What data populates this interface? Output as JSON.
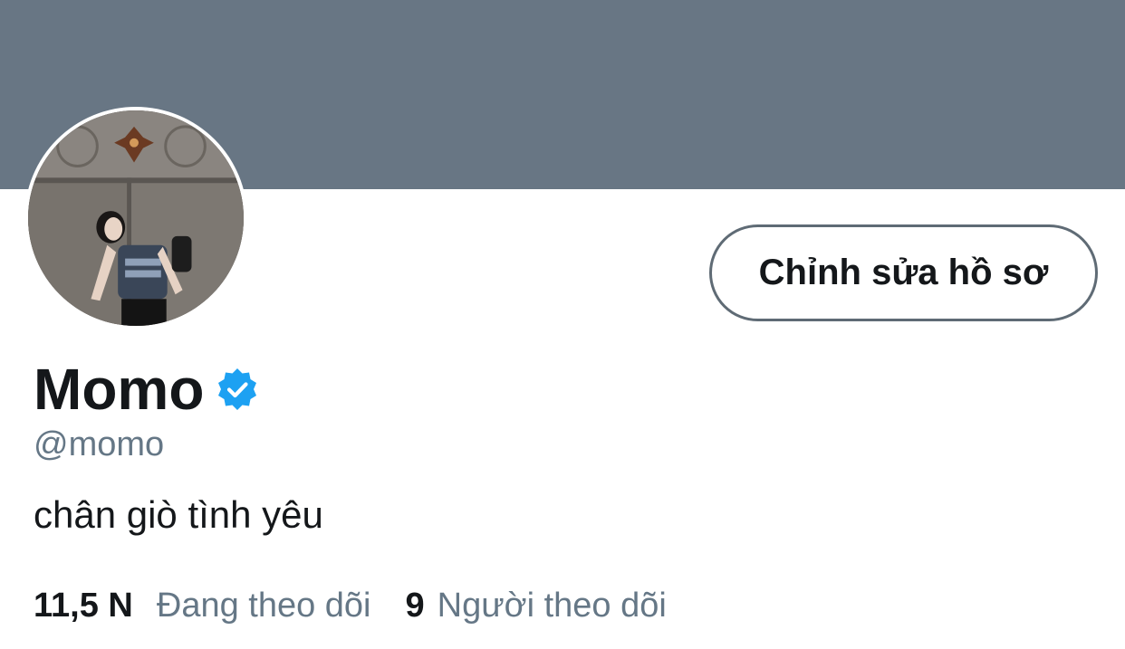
{
  "profile": {
    "display_name": "Momo",
    "handle": "@momo",
    "bio": "chân giò tình yêu",
    "edit_button_label": "Chỉnh sửa hồ sơ",
    "verified": true
  },
  "stats": {
    "following_count": "11,5 N",
    "following_label": "Đang theo dõi",
    "followers_count": "9",
    "followers_label": "Người theo dõi"
  },
  "colors": {
    "banner": "#687684",
    "verified_badge": "#1da1f2",
    "secondary_text": "#657786",
    "primary_text": "#14171a"
  },
  "icons": {
    "verified": "verified-badge-icon"
  }
}
